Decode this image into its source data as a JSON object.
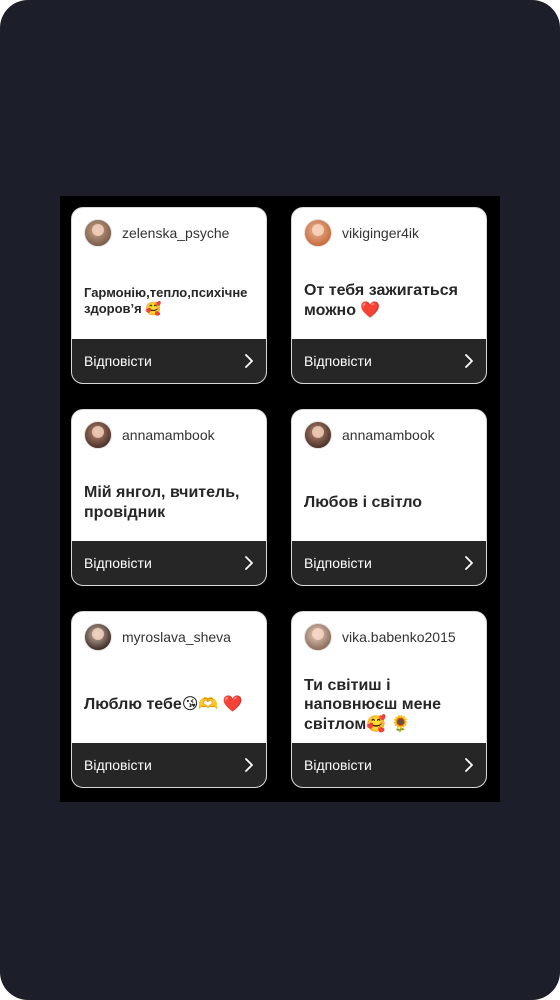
{
  "cards": [
    {
      "username": "zelenska_psyche",
      "message": "Гармонію,тепло,психічне здоров’я 🥰",
      "message_size": 13,
      "avatar_colors": [
        "#7a5a4a",
        "#c9a48a"
      ],
      "reply_label": "Відповісти"
    },
    {
      "username": "vikiginger4ik",
      "message": "От тебя зажигаться можно ❤️",
      "message_size": 16,
      "avatar_colors": [
        "#c8683a",
        "#e8b89a"
      ],
      "reply_label": "Відповісти"
    },
    {
      "username": "annamambook",
      "message": "Мій янгол, вчитель, провідник",
      "message_size": 16,
      "avatar_colors": [
        "#4a3028",
        "#b88870"
      ],
      "reply_label": "Відповісти"
    },
    {
      "username": "annamambook",
      "message": "Любов і світло",
      "message_size": 16,
      "avatar_colors": [
        "#4a3028",
        "#b88870"
      ],
      "reply_label": "Відповісти"
    },
    {
      "username": "myroslava_sheva",
      "message": "Люблю тебе😘🫶 ❤️",
      "message_size": 16,
      "avatar_colors": [
        "#3a2a24",
        "#d0b8a8"
      ],
      "reply_label": "Відповісти"
    },
    {
      "username": "vika.babenko2015",
      "message": "Ти світиш і наповнюєш мене світлом🥰 🌻",
      "message_size": 16,
      "avatar_colors": [
        "#8a6a58",
        "#e8d0c0"
      ],
      "reply_label": "Відповісти"
    }
  ]
}
